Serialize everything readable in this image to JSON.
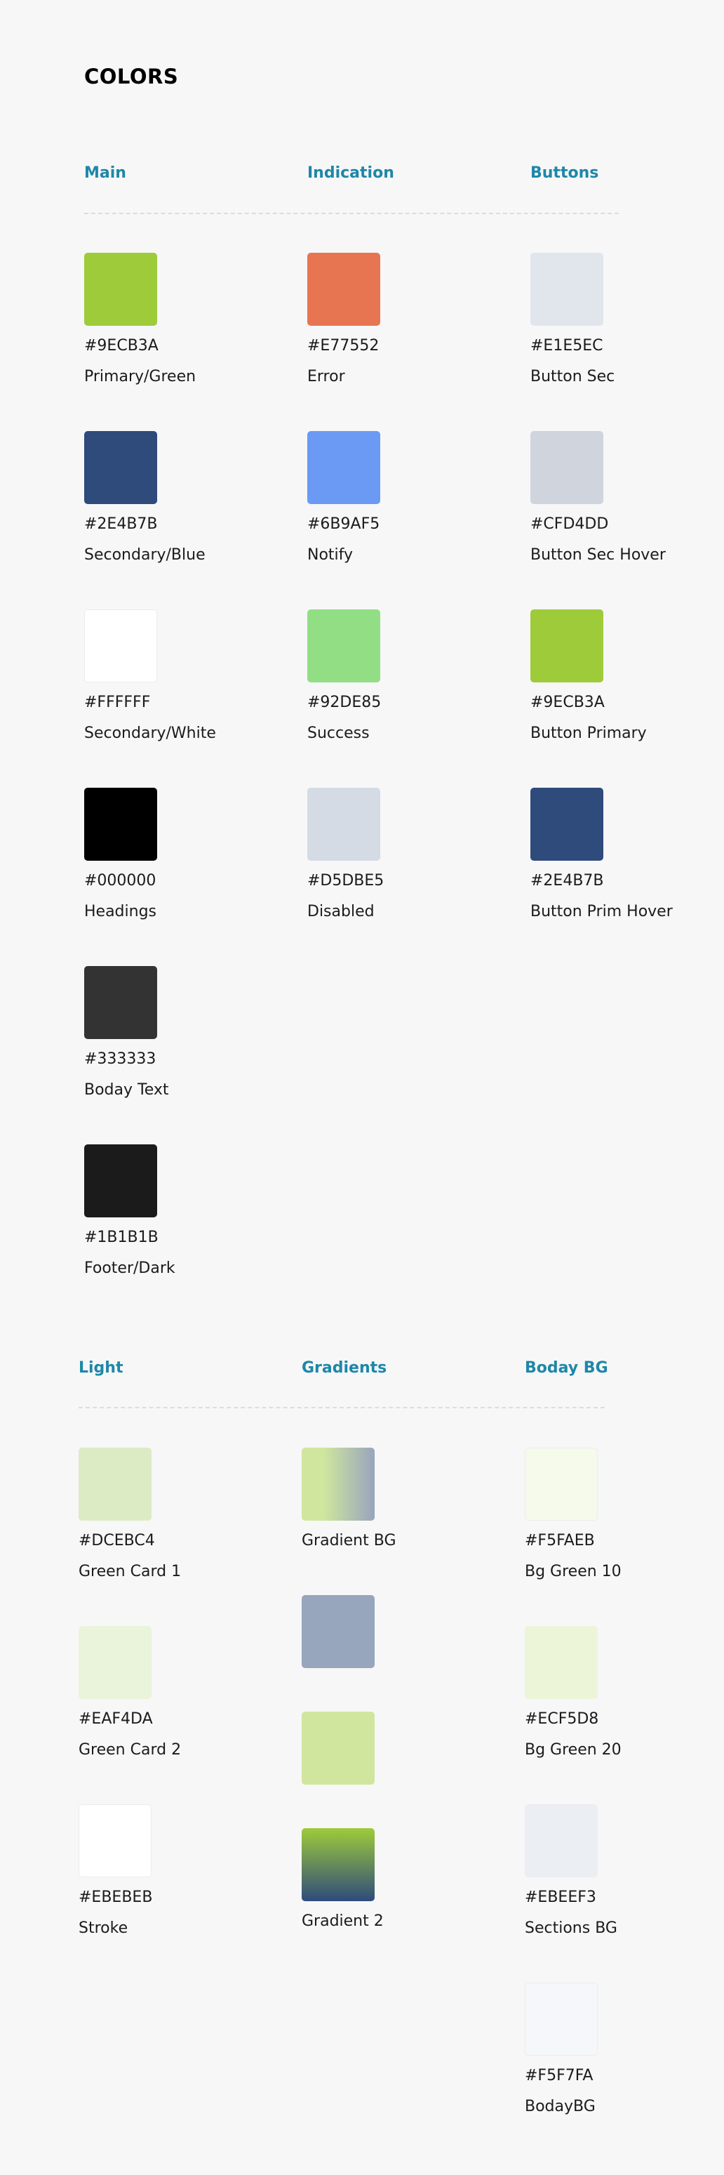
{
  "page_title": "COLORS",
  "accent_color": "#1E87A8",
  "sections": [
    {
      "columns": [
        {
          "heading": "Main",
          "swatches": [
            {
              "hex": "#9ECB3A",
              "label": "Primary/Green",
              "color": "#9ECB3A"
            },
            {
              "hex": "#2E4B7B",
              "label": "Secondary/Blue",
              "color": "#2E4B7B"
            },
            {
              "hex": "#FFFFFF",
              "label": "Secondary/White",
              "color": "#FFFFFF"
            },
            {
              "hex": "#000000",
              "label": "Headings",
              "color": "#000000"
            },
            {
              "hex": "#333333",
              "label": "Boday Text",
              "color": "#333333"
            },
            {
              "hex": "#1B1B1B",
              "label": "Footer/Dark",
              "color": "#1B1B1B"
            }
          ]
        },
        {
          "heading": "Indication",
          "swatches": [
            {
              "hex": "#E77552",
              "label": "Error",
              "color": "#E77552"
            },
            {
              "hex": "#6B9AF5",
              "label": "Notify",
              "color": "#6B9AF5"
            },
            {
              "hex": "#92DE85",
              "label": "Success",
              "color": "#92DE85"
            },
            {
              "hex": "#D5DBE5",
              "label": "Disabled",
              "color": "#D5DBE5"
            }
          ]
        },
        {
          "heading": "Buttons",
          "swatches": [
            {
              "hex": "#E1E5EC",
              "label": "Button Sec",
              "color": "#E1E5EC"
            },
            {
              "hex": "#CFD4DD",
              "label": "Button Sec Hover",
              "color": "#CFD4DD"
            },
            {
              "hex": "#9ECB3A",
              "label": "Button Primary",
              "color": "#9ECB3A"
            },
            {
              "hex": "#2E4B7B",
              "label": "Button Prim Hover",
              "color": "#2E4B7B"
            }
          ]
        }
      ]
    },
    {
      "columns": [
        {
          "heading": "Light",
          "swatches": [
            {
              "hex": "#DCEBC4",
              "label": "Green Card 1",
              "color": "#DCEBC4"
            },
            {
              "hex": "#EAF4DA",
              "label": "Green Card 2",
              "color": "#EAF4DA"
            },
            {
              "hex": "#EBEBEB",
              "label": "Stroke",
              "color": "#FFFFFF"
            }
          ]
        },
        {
          "heading": "Gradients",
          "swatches": [
            {
              "label": "Gradient BG",
              "gradient": "linear-gradient(to right, #D0E69E 0%, #D0E69E 30%, #97A5BD 100%)"
            },
            {
              "color": "#97A5BD"
            },
            {
              "color": "#D0E69E"
            },
            {
              "label": "Gradient 2",
              "gradient": "linear-gradient(to bottom, #9ECB3A 0%, #2E4B7B 100%)"
            }
          ]
        },
        {
          "heading": "Boday BG",
          "swatches": [
            {
              "hex": "#F5FAEB",
              "label": "Bg Green 10",
              "color": "#F5FAEB"
            },
            {
              "hex": "#ECF5D8",
              "label": "Bg Green 20",
              "color": "#ECF5D8"
            },
            {
              "hex": "#EBEEF3",
              "label": "Sections BG",
              "color": "#EBEEF3"
            },
            {
              "hex": "#F5F7FA",
              "label": "BodayBG",
              "color": "#F5F7FA"
            }
          ]
        }
      ]
    }
  ]
}
